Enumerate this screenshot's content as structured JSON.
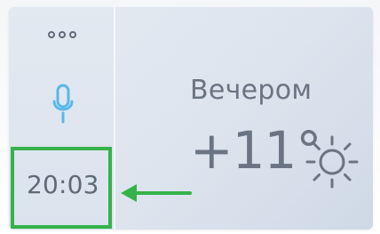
{
  "sidebar": {
    "menu_icon": "more-horizontal-dots-icon",
    "mic_icon": "microphone-icon"
  },
  "time": {
    "value": "20:03"
  },
  "weather": {
    "period_label": "Вечером",
    "temperature": "+11°",
    "condition_icon": "sun-icon"
  },
  "colors": {
    "highlight": "#35b34a",
    "mic": "#58b8e8",
    "text": "#6a7483"
  }
}
